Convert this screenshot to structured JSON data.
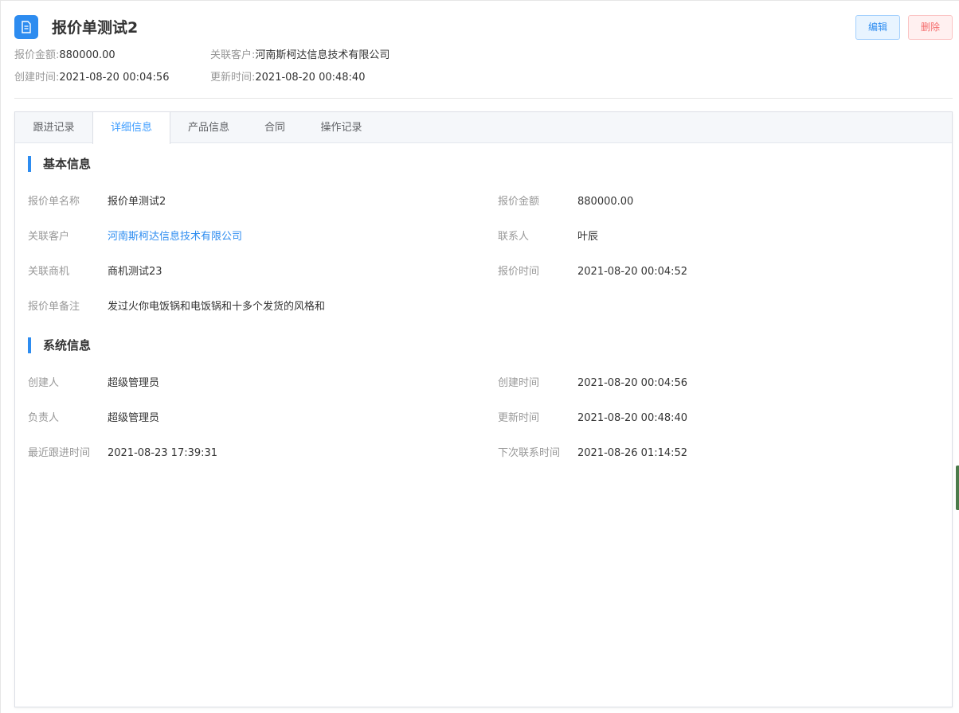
{
  "header": {
    "title": "报价单测试2",
    "edit_label": "编辑",
    "delete_label": "删除"
  },
  "summary": {
    "amount_label": "报价金额:",
    "amount_value": "880000.00",
    "customer_label": "关联客户:",
    "customer_value": "河南斯柯达信息技术有限公司",
    "created_label": "创建时间:",
    "created_value": "2021-08-20 00:04:56",
    "updated_label": "更新时间:",
    "updated_value": "2021-08-20 00:48:40"
  },
  "tabs": [
    {
      "label": "跟进记录"
    },
    {
      "label": "详细信息"
    },
    {
      "label": "产品信息"
    },
    {
      "label": "合同"
    },
    {
      "label": "操作记录"
    }
  ],
  "active_tab": "详细信息",
  "basic_info": {
    "title": "基本信息",
    "fields": [
      {
        "label": "报价单名称",
        "value": "报价单测试2"
      },
      {
        "label": "报价金额",
        "value": "880000.00"
      },
      {
        "label": "关联客户",
        "value": "河南斯柯达信息技术有限公司"
      },
      {
        "label": "联系人",
        "value": "叶辰"
      },
      {
        "label": "关联商机",
        "value": "商机测试23"
      },
      {
        "label": "报价时间",
        "value": "2021-08-20 00:04:52"
      },
      {
        "label": "报价单备注",
        "value": "发过火你电饭锅和电饭锅和十多个发货的风格和"
      }
    ]
  },
  "system_info": {
    "title": "系统信息",
    "fields": [
      {
        "label": "创建人",
        "value": "超级管理员"
      },
      {
        "label": "创建时间",
        "value": "2021-08-20 00:04:56"
      },
      {
        "label": "负责人",
        "value": "超级管理员"
      },
      {
        "label": "更新时间",
        "value": "2021-08-20 00:48:40"
      },
      {
        "label": "最近跟进时间",
        "value": "2021-08-23 17:39:31"
      },
      {
        "label": "下次联系时间",
        "value": "2021-08-26 01:14:52"
      }
    ]
  },
  "colors": {
    "accent": "#2d8cf0",
    "tab_active": "#409eff",
    "danger": "#f56c6c"
  },
  "icons": {
    "header_icon": "document-icon"
  }
}
